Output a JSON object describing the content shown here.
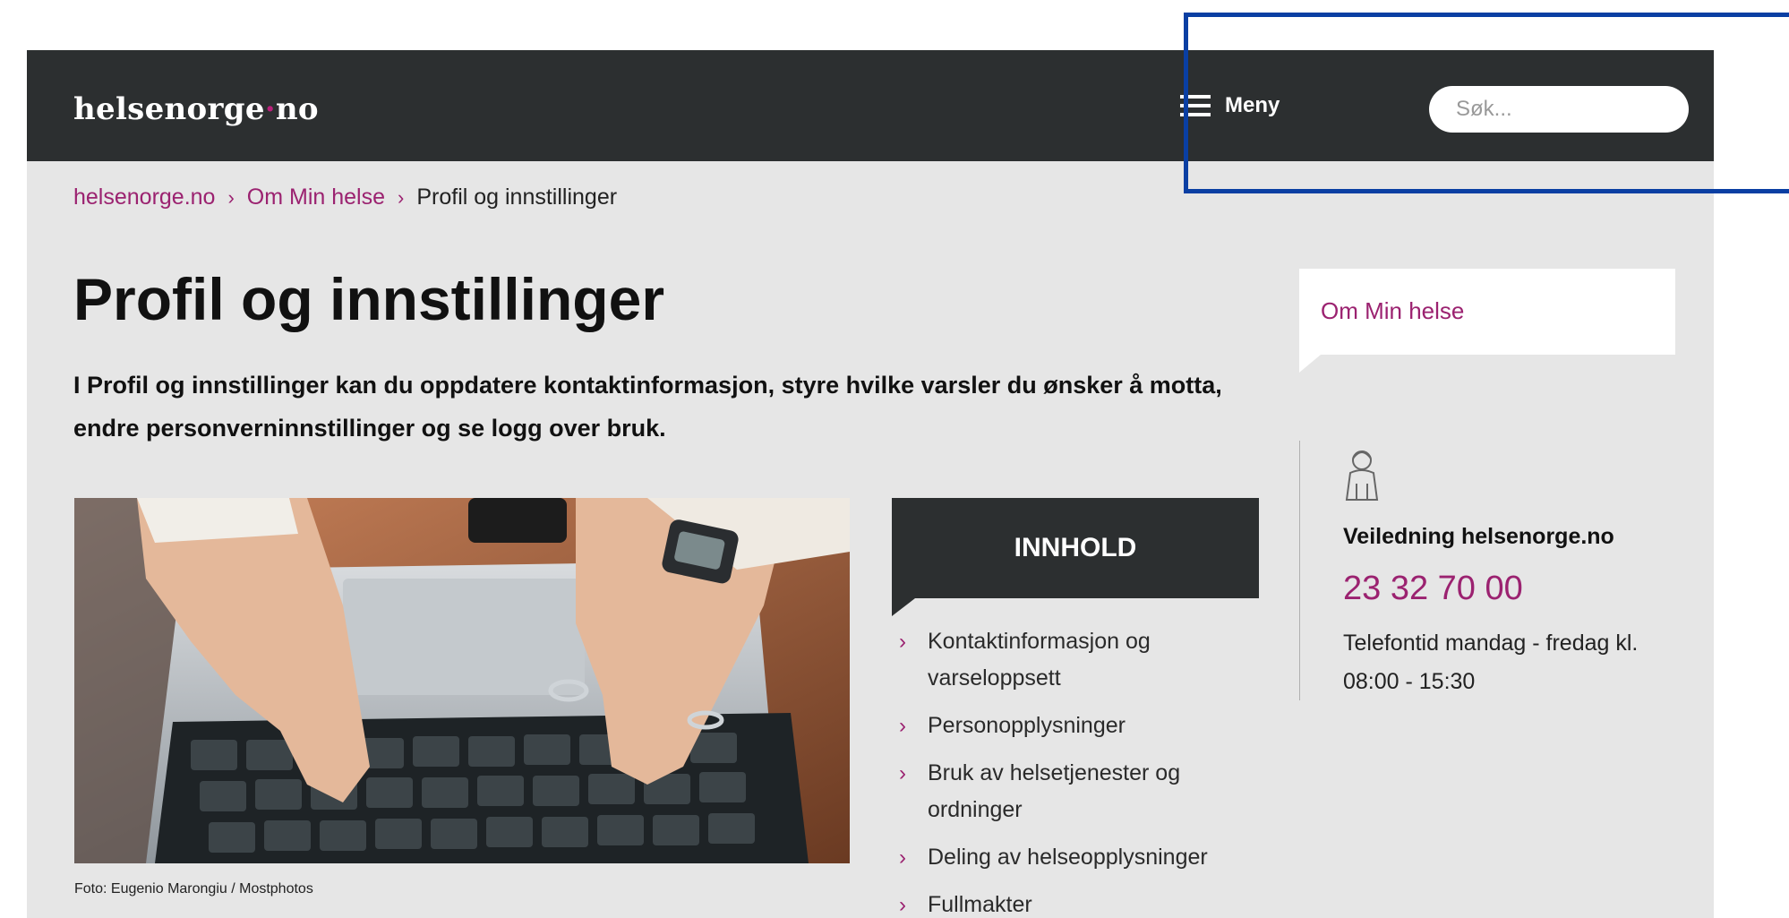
{
  "header": {
    "logo_main": "helsenorge",
    "logo_dot": "·",
    "logo_tld": "no",
    "menu_label": "Meny",
    "search_placeholder": "Søk..."
  },
  "breadcrumb": {
    "items": [
      "helsenorge.no",
      "Om Min helse"
    ],
    "current": "Profil og innstillinger"
  },
  "main": {
    "title": "Profil og innstillinger",
    "lead": "I Profil og innstillinger kan du oppdatere kontaktinformasjon, styre hvilke varsler du ønsker å motta, endre personverninnstillinger og se logg over bruk.",
    "photo_credit": "Foto: Eugenio Marongiu / Mostphotos"
  },
  "toc": {
    "heading": "INNHOLD",
    "items": [
      "Kontaktinformasjon og varseloppsett",
      "Personopplysninger",
      "Bruk av helsetjenester og ordninger",
      "Deling av helseopplysninger",
      "Fullmakter"
    ]
  },
  "sidebar": {
    "section_link": "Om Min helse",
    "help_title": "Veiledning helsenorge.no",
    "phone": "23 32 70 00",
    "hours": "Telefontid mandag - fredag kl. 08:00 - 15:30"
  },
  "colors": {
    "header_bg": "#2c2f30",
    "page_bg": "#e6e6e6",
    "accent": "#9b2270",
    "highlight_box": "#0a3fa3"
  },
  "icons": {
    "menu": "hamburger-icon",
    "search": "search-icon",
    "chevron": "chevron-right-icon",
    "support": "person-support-icon"
  }
}
